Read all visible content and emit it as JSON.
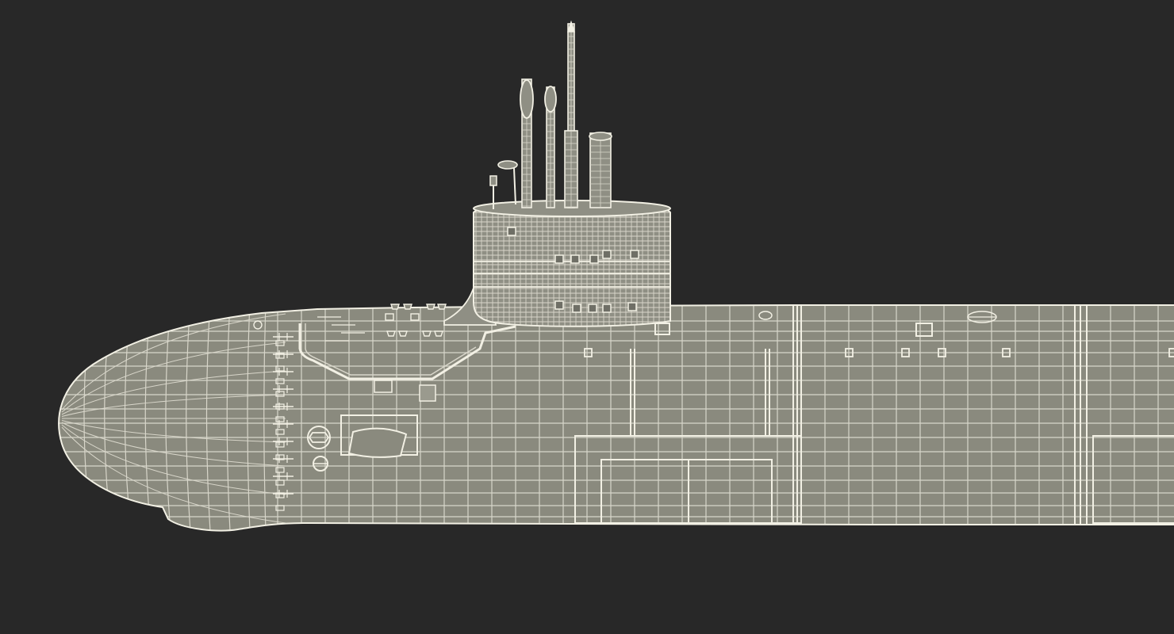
{
  "scene": {
    "background_color": "#282828",
    "hull_fill_color": "#8a8a7e",
    "sail_fill_color": "#8f8f84",
    "wire_color": "#f2f0e4",
    "wire_color_dim": "#d8d6ca",
    "subject": "submarine-wireframe"
  }
}
